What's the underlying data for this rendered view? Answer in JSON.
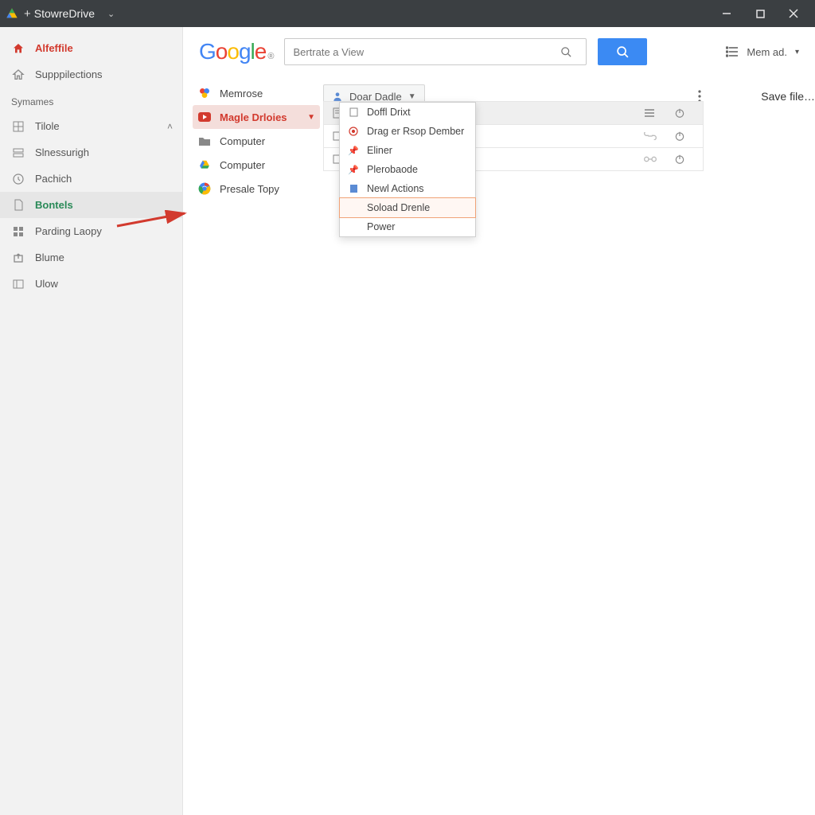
{
  "window": {
    "title": "StowreDrive"
  },
  "sidebar": {
    "items": [
      {
        "label": "Alfeffile",
        "style": "red",
        "icon": "home"
      },
      {
        "label": "Supppilections",
        "style": "",
        "icon": "home-outline"
      }
    ],
    "section_label": "Symames",
    "nav": [
      {
        "label": "Tilole",
        "icon": "grid",
        "expand": true
      },
      {
        "label": "Slnessurigh",
        "icon": "rows"
      },
      {
        "label": "Pachich",
        "icon": "clock"
      },
      {
        "label": "Bontels",
        "icon": "doc",
        "style": "green"
      },
      {
        "label": "Parding Laopy",
        "icon": "squares"
      },
      {
        "label": "Blume",
        "icon": "export"
      },
      {
        "label": "Ulow",
        "icon": "panel"
      }
    ]
  },
  "header": {
    "logo_sup": "®",
    "search_placeholder": "Bertrate a View",
    "account_label": "Mem ad."
  },
  "drivetree": [
    {
      "label": "Memrose",
      "icon": "gphoto"
    },
    {
      "label": "Magle Drloies",
      "icon": "youtube",
      "active": true
    },
    {
      "label": "Computer",
      "icon": "folder"
    },
    {
      "label": "Computer",
      "icon": "drive"
    },
    {
      "label": "Presale Topy",
      "icon": "chrome"
    }
  ],
  "toolbar": {
    "crumb_label": "Doar Dadle",
    "save_label": "Save file…"
  },
  "files": [
    {
      "icon": "doc",
      "act1": "menu",
      "act2": "power"
    },
    {
      "icon": "box",
      "act1": "link",
      "act2": "power"
    },
    {
      "icon": "box",
      "act1": "link",
      "act2": "power"
    }
  ],
  "menu": [
    {
      "label": "Doffl Drixt",
      "icon": "page"
    },
    {
      "label": "Drag er Rsop Dember",
      "icon": "target"
    },
    {
      "label": "Eliner",
      "icon": "pin"
    },
    {
      "label": "Plerobaode",
      "icon": "pin"
    },
    {
      "label": "Newl Actions",
      "icon": "doc"
    },
    {
      "label": "Soload Drenle",
      "icon": "",
      "highlight": true
    },
    {
      "label": "Power",
      "icon": ""
    }
  ]
}
